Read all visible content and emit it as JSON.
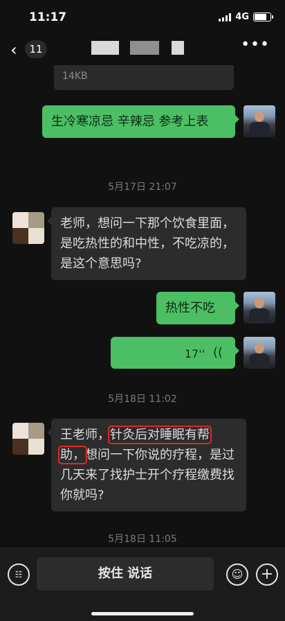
{
  "status": {
    "time": "11:17",
    "network": "4G"
  },
  "nav": {
    "back_count": "11"
  },
  "file": {
    "size": "14KB"
  },
  "messages": {
    "m1": "生冷寒凉忌 辛辣忌  参考上表",
    "ts1": "5月17日 21:07",
    "m2": "老师，想问一下那个饮食里面，是吃热性的和中性，不吃凉的，是这个意思吗?",
    "m3": "热性不吃",
    "m4_duration": "17''",
    "ts2": "5月18日 11:02",
    "m5": {
      "part1": "王老师，",
      "highlight_a": "针灸后对睡眠有帮",
      "highlight_b": "助，",
      "part2": "想问一下你说的疗程，是过几天来了找护士开个疗程缴费找你就吗?"
    },
    "ts3": "5月18日 11:05"
  },
  "input": {
    "hold_to_talk": "按住 说话"
  },
  "icons": {
    "back": "back-chevron-icon",
    "more": "more-dots-icon",
    "voice": "voice-wave-icon",
    "keyboard": "keyboard-icon",
    "emoji": "emoji-icon",
    "add": "add-icon"
  },
  "colors": {
    "bubble_me": "#4cbf64",
    "bubble_them": "#2c2c2c",
    "highlight": "#e0262b"
  }
}
